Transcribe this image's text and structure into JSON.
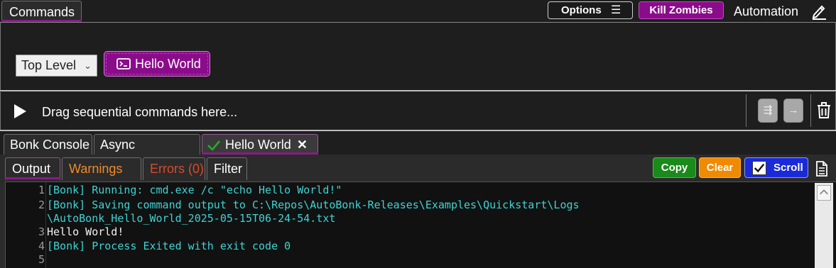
{
  "header": {
    "commands_tab": "Commands",
    "options_label": "Options",
    "kill_label": "Kill Zombies",
    "automation_label": "Automation"
  },
  "commands": {
    "level_select": "Top Level",
    "hello_button": "Hello World"
  },
  "sequence": {
    "drag_text": "Drag sequential commands here..."
  },
  "bottom_tabs": [
    {
      "label": "Bonk Console"
    },
    {
      "label": "Async Sequences"
    },
    {
      "label": "Hello World"
    }
  ],
  "output_tabs": [
    {
      "label": "Output"
    },
    {
      "label": "Warnings (0)"
    },
    {
      "label": "Errors (0)"
    },
    {
      "label": "Filter"
    }
  ],
  "actions": {
    "copy": "Copy",
    "clear": "Clear",
    "scroll": "Scroll"
  },
  "console": {
    "line_numbers": [
      "1",
      "2",
      "3",
      "4",
      "5"
    ],
    "lines": [
      "[Bonk] Running: cmd.exe /c \"echo Hello World!\"",
      "[Bonk] Saving command output to C:\\Repos\\AutoBonk-Releases\\Examples\\Quickstart\\Logs",
      "\\AutoBonk_Hello_World_2025-05-15T06-24-54.txt",
      "Hello World!",
      "[Bonk] Process Exited with exit code 0"
    ]
  },
  "colors": {
    "accent_purple": "#8a0c8a",
    "copy_green": "#1a8a1a",
    "clear_orange": "#f08a00",
    "scroll_blue": "#1a2ad8",
    "warnings_text": "#f08a2a",
    "errors_text": "#d94a2a",
    "bonk_text": "#3ed3d3"
  }
}
